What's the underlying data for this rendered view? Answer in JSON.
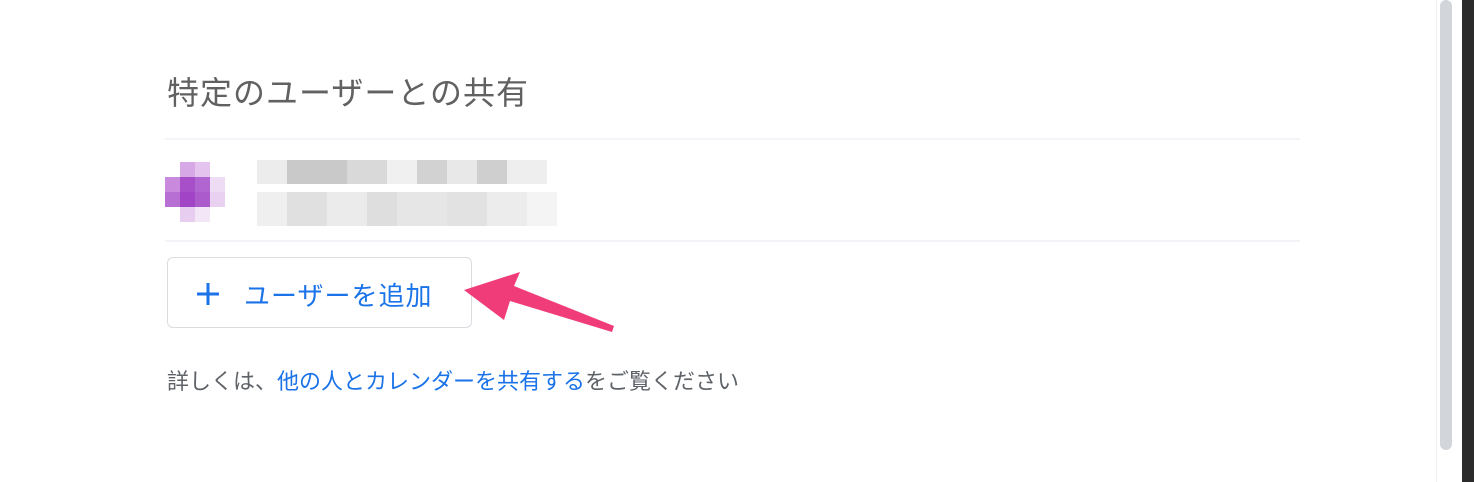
{
  "section": {
    "title": "特定のユーザーとの共有"
  },
  "shared_users": [
    {
      "avatar_color": "#a64fc9",
      "name": "",
      "email": ""
    }
  ],
  "add_user_button": {
    "icon": "plus-icon",
    "label": "ユーザーを追加"
  },
  "help": {
    "prefix": "詳しくは、",
    "link_text": "他の人とカレンダーを共有する",
    "suffix": "をご覧ください"
  },
  "colors": {
    "accent": "#1a73e8",
    "annotation_arrow": "#f03c78",
    "text_secondary": "#5f6368"
  }
}
